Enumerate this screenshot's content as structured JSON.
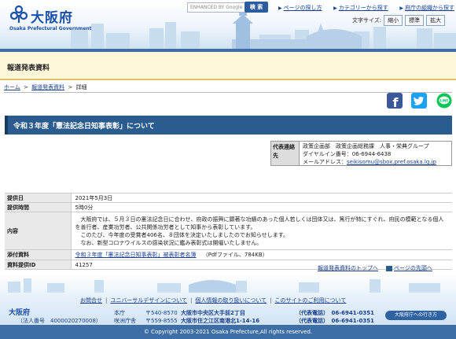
{
  "header": {
    "logo_name": "大阪府",
    "logo_en": "Osaka Prefectural Government",
    "search_placeholder": "ENHANCED BY Google",
    "search_button": "検 索",
    "links": [
      "ページの探し方",
      "カテゴリーから探す",
      "府庁の組織から探す"
    ],
    "fontsize_label": "文字サイズ:",
    "fontsize_options": [
      "縮小",
      "標準",
      "拡大"
    ]
  },
  "category": {
    "title": "報道発表資料"
  },
  "breadcrumb": [
    "ホーム",
    "報道発表資料",
    "詳細"
  ],
  "share": {
    "facebook": "f",
    "twitter": "twitter",
    "line": "LINE"
  },
  "title": "令和３年度「憲法記念日知事表彰」について",
  "contact": {
    "label": "代表連絡先",
    "dept": "政策企画部　政策企画総務課　人事・栄典グループ",
    "dial": "ダイヤルイン番号：06-6944-6438",
    "mail_label": "メールアドレス：",
    "mail": "seikisomu@sbox.pref.osaka.lg.jp"
  },
  "info": {
    "date_label": "提供日",
    "date_value": "2021年5月3日",
    "time_label": "提供時間",
    "time_value": "5時0分",
    "content_label": "内容",
    "content_p1": "大阪府では、５月３日の憲法記念日に合わせ、府政の振興に顕著な功績のあった個人若しくは団体又は、篤行が特にすぐれ、府民の模範となる個人を善行者、産業功労者、公共関係功労者として知事から表彰しています。",
    "content_p2": "このたび、今年度の受賞者406名、８団体を決定いたしましたのでお知らせします。",
    "content_p3": "なお、新型コロナウイルスの感染状況に鑑み表彰式は開催いたしません。",
    "attach_label": "添付資料",
    "attach_link": "令和３年度「憲法記念日知事表彰」被表彰者名簿",
    "attach_meta": "（Pdfファイル、784KB）",
    "id_label": "資料提供ID",
    "id_value": "41257"
  },
  "tail_links": {
    "back_top": "報道発表資料のトップへ",
    "page_top": "ページの先頭へ"
  },
  "footer": {
    "links": [
      "お問合せ",
      "ユニバーサルデザインについて",
      "個人情報の取り扱いについて",
      "このサイトのご利用について"
    ],
    "org": "大阪府",
    "corp": "（法人番号　4000020270008）",
    "office1": "本庁",
    "office2": "咲洲庁舎",
    "zip1": "〒540-8570",
    "zip2": "〒559-8555",
    "addr1": "大阪市中央区大手前2丁目",
    "addr2": "大阪市住之江区南港北1-14-16",
    "tel1": "（代表電話）　06-6941-0351",
    "tel2": "（代表電話）　06-6941-0351",
    "access": "大阪府庁への行き方",
    "copyright": "© Copyright 2003-2021 Osaka Prefecture,All rights reserved."
  }
}
